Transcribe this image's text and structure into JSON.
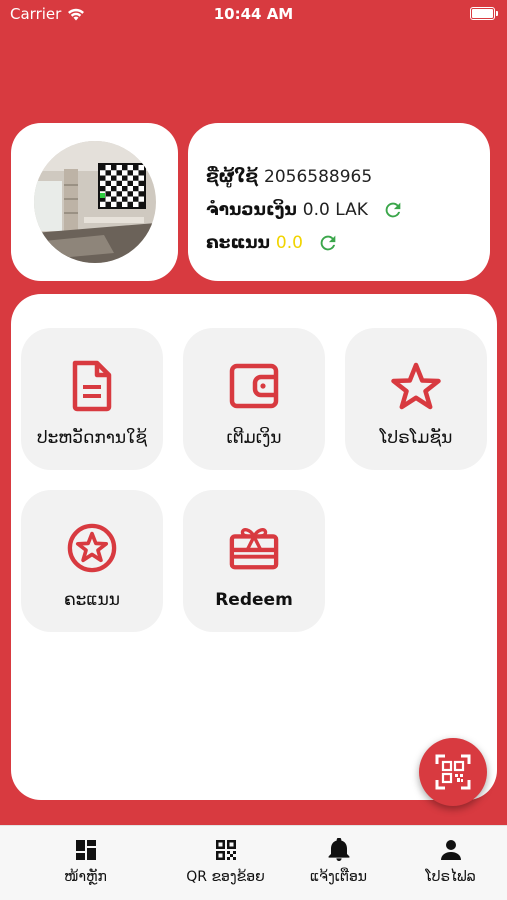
{
  "status_bar": {
    "carrier": "Carrier",
    "time": "10:44 AM"
  },
  "profile": {
    "username_label": "ຊື່ຜູ້ໃຊ້",
    "username_value": "2056588965",
    "balance_label": "ຈຳນວນເງິນ",
    "balance_value": "0.0 LAK",
    "points_label": "ຄະແນນ",
    "points_value": "0.0"
  },
  "menu": [
    {
      "label": "ປະຫວັດການໃຊ້",
      "icon": "document-icon"
    },
    {
      "label": "ເຕີມເງິນ",
      "icon": "wallet-icon"
    },
    {
      "label": "ໂປຣໂມຊັນ",
      "icon": "star-icon"
    },
    {
      "label": "ຄະແນນ",
      "icon": "star-circle-icon"
    },
    {
      "label": "Redeem",
      "icon": "gift-card-icon"
    }
  ],
  "tabs": [
    {
      "label": "ໜ້າຫຼັກ",
      "icon": "dashboard-icon"
    },
    {
      "label": "QR ຂອງຂ້ອຍ",
      "icon": "qr-code-icon"
    },
    {
      "label": "ແຈ້ງເຕືອນ",
      "icon": "bell-icon"
    },
    {
      "label": "ໂປຣໄຟລ",
      "icon": "person-icon"
    }
  ],
  "colors": {
    "brand_red": "#d83a40",
    "refresh_green": "#3aa64a",
    "points_yellow": "#f1d400",
    "tile_bg": "#f2f2f2"
  }
}
